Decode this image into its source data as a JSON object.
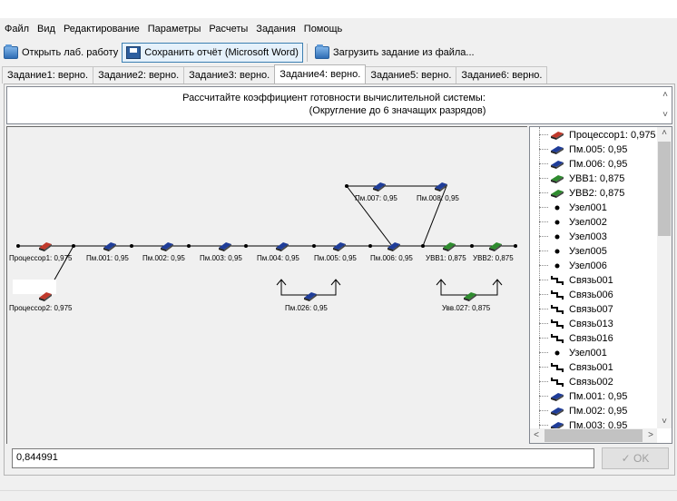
{
  "menu": [
    "Файл",
    "Вид",
    "Редактирование",
    "Параметры",
    "Расчеты",
    "Задания",
    "Помощь"
  ],
  "toolbar": {
    "open_label": "Открыть лаб. работу",
    "save_label": "Сохранить отчёт (Microsoft Word)",
    "load_label": "Загрузить задание из файла..."
  },
  "tabs": [
    "Задание1: верно.",
    "Задание2: верно.",
    "Задание3: верно.",
    "Задание4: верно.",
    "Задание5: верно.",
    "Задание6: верно."
  ],
  "active_tab": 3,
  "task": {
    "line1": "Рассчитайте коэффициент готовности вычислительной системы:",
    "line2": "(Округление до 6 значащих разрядов)"
  },
  "diagram": {
    "labels": {
      "proc1": "Процессор1: 0,975",
      "proc2": "Процессор2: 0,975",
      "pm001": "Пм.001: 0,95",
      "pm002": "Пм.002: 0,95",
      "pm003": "Пм.003: 0,95",
      "pm004": "Пм.004: 0,95",
      "pm005": "Пм.005: 0,95",
      "pm006": "Пм.006: 0,95",
      "pm007": "Пм.007: 0,95",
      "pm008": "Пм.008: 0,95",
      "pm026": "Пм.026: 0,95",
      "uvv1": "УВВ1: 0,875",
      "uvv2": "УВВ2: 0,875",
      "uvv027": "Увв.027: 0,875"
    },
    "colors": {
      "processor": "#c0392b",
      "memory": "#1f3d99",
      "io": "#2e8b2e"
    }
  },
  "tree": {
    "items": [
      {
        "label": "Процессор1: 0,975",
        "icon": "processor-icon"
      },
      {
        "label": "Пм.005: 0,95",
        "icon": "memory-icon"
      },
      {
        "label": "Пм.006: 0,95",
        "icon": "memory-icon"
      },
      {
        "label": "УВВ1: 0,875",
        "icon": "io-icon"
      },
      {
        "label": "УВВ2: 0,875",
        "icon": "io-icon"
      },
      {
        "label": "Узел001",
        "icon": "node-icon"
      },
      {
        "label": "Узел002",
        "icon": "node-icon"
      },
      {
        "label": "Узел003",
        "icon": "node-icon"
      },
      {
        "label": "Узел005",
        "icon": "node-icon"
      },
      {
        "label": "Узел006",
        "icon": "node-icon"
      },
      {
        "label": "Связь001",
        "icon": "link-icon"
      },
      {
        "label": "Связь006",
        "icon": "link-icon"
      },
      {
        "label": "Связь007",
        "icon": "link-icon"
      },
      {
        "label": "Связь013",
        "icon": "link-icon"
      },
      {
        "label": "Связь016",
        "icon": "link-icon"
      },
      {
        "label": "Узел001",
        "icon": "node-icon"
      },
      {
        "label": "Связь001",
        "icon": "link-icon"
      },
      {
        "label": "Связь002",
        "icon": "link-icon"
      },
      {
        "label": "Пм.001: 0,95",
        "icon": "memory-icon"
      },
      {
        "label": "Пм.002: 0,95",
        "icon": "memory-icon"
      },
      {
        "label": "Пм.003: 0,95",
        "icon": "memory-icon"
      }
    ]
  },
  "answer": {
    "value": "0,844991"
  },
  "ok_label": "OK"
}
